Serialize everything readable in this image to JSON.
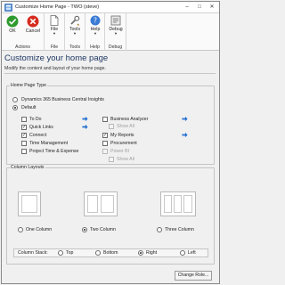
{
  "window": {
    "title": "Customize Home Page  -  TWO (steve)",
    "controls": [
      "–",
      "□",
      "✕"
    ]
  },
  "ribbon": {
    "groups": [
      {
        "label": "Actions",
        "buttons": [
          {
            "label": "OK",
            "icon": "ok-check-icon"
          },
          {
            "label": "Cancel",
            "icon": "cancel-x-icon"
          }
        ]
      },
      {
        "label": "File",
        "buttons": [
          {
            "label": "File",
            "icon": "file-icon"
          }
        ]
      },
      {
        "label": "Tools",
        "buttons": [
          {
            "label": "Tools",
            "icon": "tools-icon"
          }
        ]
      },
      {
        "label": "Help",
        "buttons": [
          {
            "label": "Help",
            "icon": "help-icon"
          }
        ]
      },
      {
        "label": "Debug",
        "buttons": [
          {
            "label": "Debug",
            "icon": "debug-icon"
          }
        ]
      }
    ]
  },
  "page": {
    "heading": "Customize your home page",
    "subheading": "Modify the content and layout of your home page."
  },
  "home_page_type": {
    "legend": "Home Page Type",
    "options": [
      {
        "label": "Dynamics 365 Business Central Insights",
        "selected": false
      },
      {
        "label": "Default",
        "selected": true
      }
    ],
    "left_items": [
      {
        "label": "To Do",
        "checked": false,
        "arrow": true
      },
      {
        "label": "Quick Links",
        "checked": true,
        "arrow": true
      },
      {
        "label": "Connect",
        "checked": true,
        "arrow": false
      },
      {
        "label": "Time Management",
        "checked": false,
        "arrow": false
      },
      {
        "label": "Project Time & Expense",
        "checked": false,
        "arrow": false
      }
    ],
    "right_items": [
      {
        "label": "Business Analyzer",
        "checked": false,
        "arrow": true,
        "disabled": false
      },
      {
        "label": "Show All",
        "checked": false,
        "arrow": false,
        "disabled": true
      },
      {
        "label": "My Reports",
        "checked": true,
        "arrow": true,
        "disabled": false
      },
      {
        "label": "Procurement",
        "checked": false,
        "arrow": false,
        "disabled": false
      },
      {
        "label": "Power BI",
        "checked": false,
        "arrow": false,
        "disabled": true
      },
      {
        "label": "Show All",
        "checked": false,
        "arrow": false,
        "disabled": true
      }
    ]
  },
  "column_layouts": {
    "legend": "Column Layouts",
    "options": [
      {
        "label": "One Column",
        "selected": false
      },
      {
        "label": "Two Column",
        "selected": true
      },
      {
        "label": "Three Column",
        "selected": false
      }
    ],
    "stack_label": "Column Stack:",
    "stack_options": [
      {
        "label": "Top",
        "selected": false
      },
      {
        "label": "Bottom",
        "selected": false
      },
      {
        "label": "Right",
        "selected": true
      },
      {
        "label": "Left",
        "selected": false
      }
    ]
  },
  "footer": {
    "change_role": "Change Role..."
  },
  "colors": {
    "heading": "#1f3864",
    "ok_green": "#2e9a2e",
    "cancel_red": "#d52b1e",
    "arrow_blue": "#1f6fd1"
  }
}
